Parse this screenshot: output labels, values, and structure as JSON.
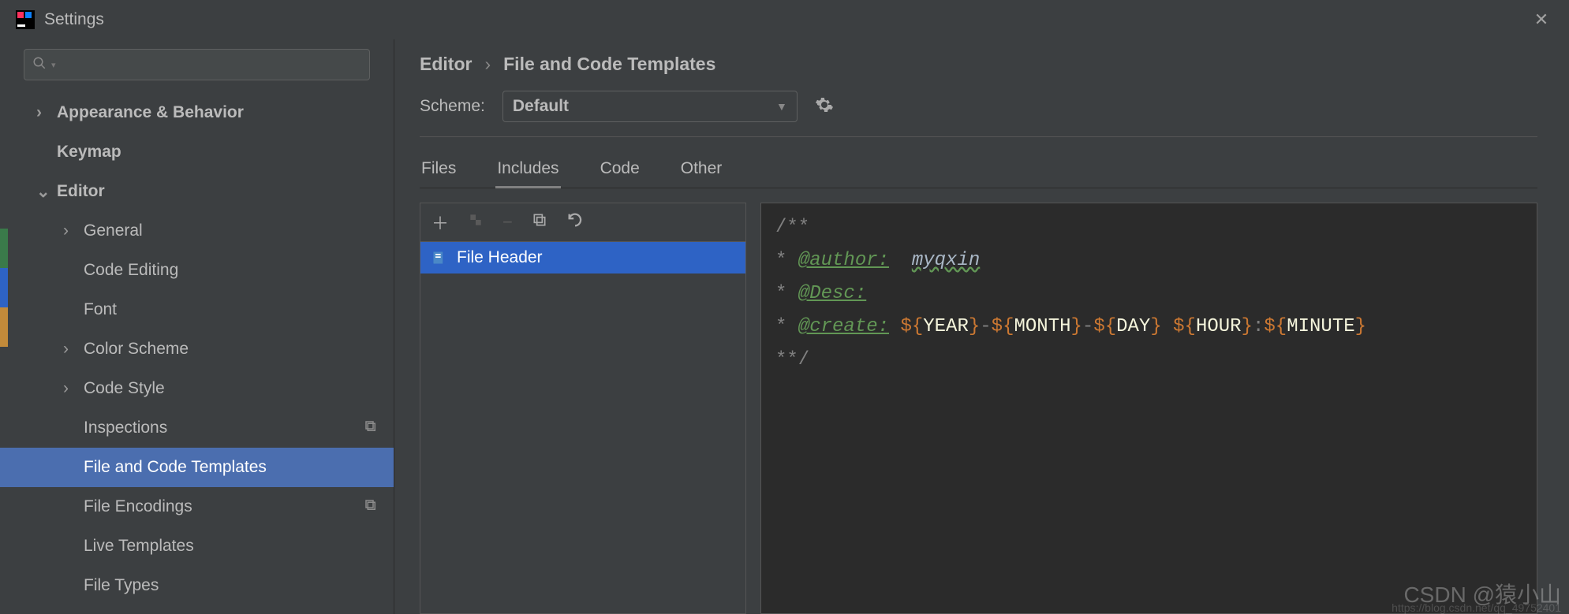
{
  "window": {
    "title": "Settings"
  },
  "sidebar": {
    "search_placeholder": "",
    "items": [
      {
        "label": "Appearance & Behavior",
        "bold": true,
        "chevron": "right",
        "level": 1
      },
      {
        "label": "Keymap",
        "bold": true,
        "level": 1
      },
      {
        "label": "Editor",
        "bold": true,
        "chevron": "down",
        "level": 1
      },
      {
        "label": "General",
        "chevron": "right",
        "level": 2
      },
      {
        "label": "Code Editing",
        "level": 2
      },
      {
        "label": "Font",
        "level": 2
      },
      {
        "label": "Color Scheme",
        "chevron": "right",
        "level": 2
      },
      {
        "label": "Code Style",
        "chevron": "right",
        "level": 2
      },
      {
        "label": "Inspections",
        "level": 2,
        "indicator": true
      },
      {
        "label": "File and Code Templates",
        "level": 2,
        "selected": true
      },
      {
        "label": "File Encodings",
        "level": 2,
        "indicator": true
      },
      {
        "label": "Live Templates",
        "level": 2
      },
      {
        "label": "File Types",
        "level": 2
      }
    ]
  },
  "breadcrumb": {
    "parent": "Editor",
    "current": "File and Code Templates"
  },
  "scheme": {
    "label": "Scheme:",
    "value": "Default"
  },
  "tabs": [
    {
      "label": "Files"
    },
    {
      "label": "Includes",
      "active": true
    },
    {
      "label": "Code"
    },
    {
      "label": "Other"
    }
  ],
  "templateList": {
    "items": [
      {
        "label": "File Header",
        "selected": true
      }
    ]
  },
  "code": {
    "line1": "/**",
    "author_tag": "@author:",
    "author_val": "myqxin",
    "desc_tag": "@Desc:",
    "create_tag": "@create:",
    "v_year": "YEAR",
    "v_month": "MONTH",
    "v_day": "DAY",
    "v_hour": "HOUR",
    "v_minute": "MINUTE",
    "line5": "**/"
  },
  "watermark": {
    "main": "CSDN @猿小山",
    "url": "https://blog.csdn.net/qq_49752401"
  }
}
